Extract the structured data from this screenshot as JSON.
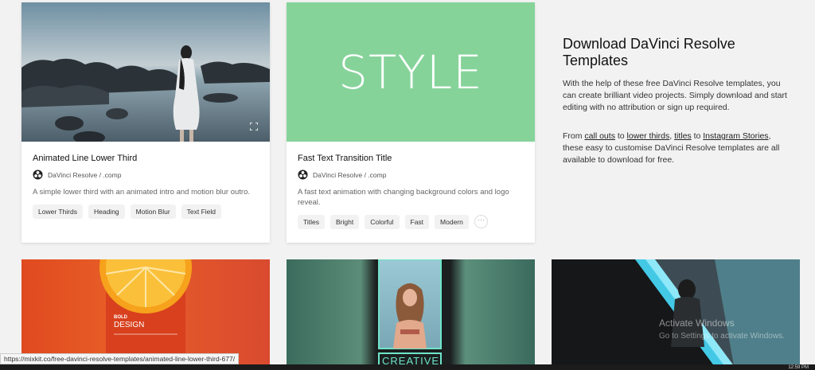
{
  "cards": [
    {
      "title": "Animated Line Lower Third",
      "meta": "DaVinci Resolve / .comp",
      "description": "A simple lower third with an animated intro and motion blur outro.",
      "tags": [
        "Lower Thirds",
        "Heading",
        "Motion Blur",
        "Text Field"
      ]
    },
    {
      "image_text": "STYLE",
      "title": "Fast Text Transition Title",
      "meta": "DaVinci Resolve / .comp",
      "description": "A fast text animation with changing background colors and logo reveal.",
      "tags": [
        "Titles",
        "Bright",
        "Colorful",
        "Fast",
        "Modern"
      ],
      "more": "···"
    }
  ],
  "side": {
    "title": "Download DaVinci Resolve Templates",
    "para1": "With the help of these free DaVinci Resolve templates, you can create brilliant video projects. Simply download and start editing with no attribution or sign up required.",
    "para2_pre": "From ",
    "link_callouts": "call outs",
    "sep1": " to ",
    "link_lowerthirds": "lower thirds",
    "sep2": ", ",
    "link_titles": "titles",
    "sep3": " to ",
    "link_instagram": "Instagram Stories",
    "para2_post": ", these easy to customise DaVinci Resolve templates are all available to download for free."
  },
  "bottom": {
    "bold": "BOLD",
    "design": "DESIGN",
    "creative": "CREATIVE"
  },
  "watermark": {
    "line1": "Activate Windows",
    "line2": "Go to Settings to activate Windows."
  },
  "status_url": "https://mixkit.co/free-davinci-resolve-templates/animated-line-lower-third-677/",
  "clock": "12:59 PM",
  "colors": {
    "style_green": "#86d39a",
    "orange": "#e85f28"
  }
}
